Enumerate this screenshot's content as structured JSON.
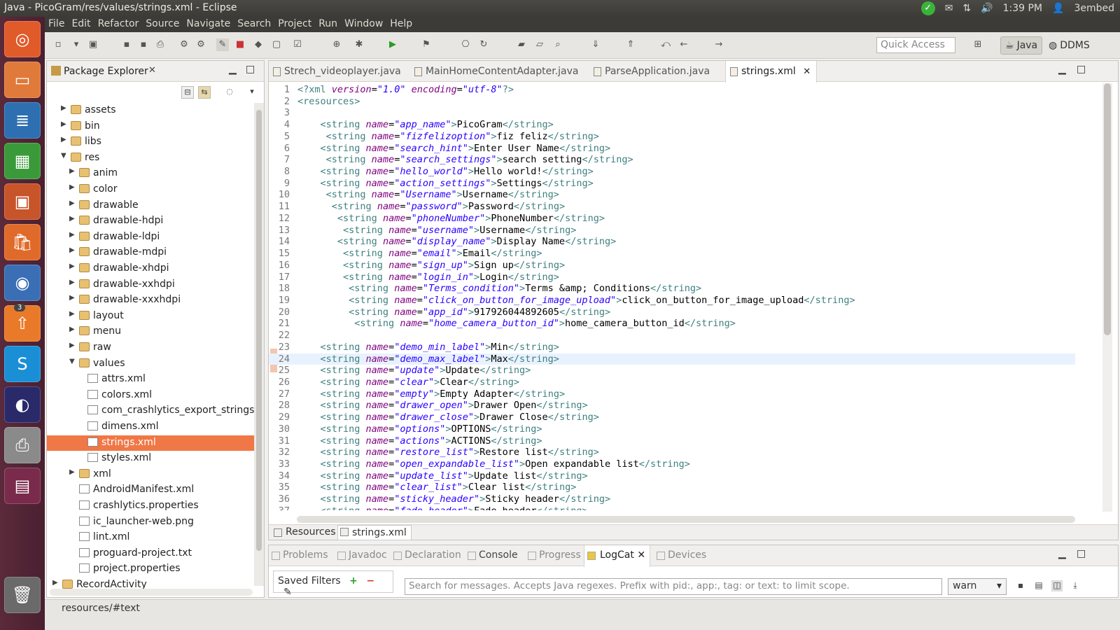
{
  "window_title": "Java - PicoGram/res/values/strings.xml - Eclipse",
  "indicators": {
    "time": "1:39 PM",
    "user": "3embed"
  },
  "launcher": {
    "badge": "3"
  },
  "menu": [
    "File",
    "Edit",
    "Refactor",
    "Source",
    "Navigate",
    "Search",
    "Project",
    "Run",
    "Window",
    "Help"
  ],
  "toolbar": {
    "quick_access_placeholder": "Quick Access"
  },
  "perspectives": {
    "java": "Java",
    "ddms": "DDMS"
  },
  "package_explorer": {
    "title": "Package Explorer",
    "tree": [
      {
        "label": "assets",
        "depth": 0,
        "type": "folder",
        "twisty": "▶"
      },
      {
        "label": "bin",
        "depth": 0,
        "type": "folder",
        "twisty": "▶"
      },
      {
        "label": "libs",
        "depth": 0,
        "type": "folder",
        "twisty": "▶"
      },
      {
        "label": "res",
        "depth": 0,
        "type": "folder",
        "twisty": "▼"
      },
      {
        "label": "anim",
        "depth": 1,
        "type": "folder",
        "twisty": "▶"
      },
      {
        "label": "color",
        "depth": 1,
        "type": "folder",
        "twisty": "▶"
      },
      {
        "label": "drawable",
        "depth": 1,
        "type": "folder",
        "twisty": "▶"
      },
      {
        "label": "drawable-hdpi",
        "depth": 1,
        "type": "folder",
        "twisty": "▶"
      },
      {
        "label": "drawable-ldpi",
        "depth": 1,
        "type": "folder",
        "twisty": "▶"
      },
      {
        "label": "drawable-mdpi",
        "depth": 1,
        "type": "folder",
        "twisty": "▶"
      },
      {
        "label": "drawable-xhdpi",
        "depth": 1,
        "type": "folder",
        "twisty": "▶"
      },
      {
        "label": "drawable-xxhdpi",
        "depth": 1,
        "type": "folder",
        "twisty": "▶"
      },
      {
        "label": "drawable-xxxhdpi",
        "depth": 1,
        "type": "folder",
        "twisty": "▶"
      },
      {
        "label": "layout",
        "depth": 1,
        "type": "folder",
        "twisty": "▶"
      },
      {
        "label": "menu",
        "depth": 1,
        "type": "folder",
        "twisty": "▶"
      },
      {
        "label": "raw",
        "depth": 1,
        "type": "folder",
        "twisty": "▶"
      },
      {
        "label": "values",
        "depth": 1,
        "type": "folder",
        "twisty": "▼"
      },
      {
        "label": "attrs.xml",
        "depth": 2,
        "type": "file",
        "twisty": ""
      },
      {
        "label": "colors.xml",
        "depth": 2,
        "type": "file",
        "twisty": ""
      },
      {
        "label": "com_crashlytics_export_strings.xr",
        "depth": 2,
        "type": "file",
        "twisty": ""
      },
      {
        "label": "dimens.xml",
        "depth": 2,
        "type": "file",
        "twisty": ""
      },
      {
        "label": "strings.xml",
        "depth": 2,
        "type": "file",
        "twisty": "",
        "selected": true
      },
      {
        "label": "styles.xml",
        "depth": 2,
        "type": "file",
        "twisty": ""
      },
      {
        "label": "xml",
        "depth": 1,
        "type": "folder",
        "twisty": "▶"
      },
      {
        "label": "AndroidManifest.xml",
        "depth": 1,
        "type": "file",
        "twisty": ""
      },
      {
        "label": "crashlytics.properties",
        "depth": 1,
        "type": "file",
        "twisty": ""
      },
      {
        "label": "ic_launcher-web.png",
        "depth": 1,
        "type": "file",
        "twisty": ""
      },
      {
        "label": "lint.xml",
        "depth": 1,
        "type": "file",
        "twisty": ""
      },
      {
        "label": "proguard-project.txt",
        "depth": 1,
        "type": "file",
        "twisty": ""
      },
      {
        "label": "project.properties",
        "depth": 1,
        "type": "file",
        "twisty": ""
      },
      {
        "label": "RecordActivity",
        "depth": -1,
        "type": "folder",
        "twisty": "▶"
      }
    ]
  },
  "editor": {
    "tabs": [
      "Strech_videoplayer.java",
      "MainHomeContentAdapter.java",
      "ParseApplication.java",
      "strings.xml"
    ],
    "active_tab": 3,
    "bottom_tabs": [
      "Resources",
      "strings.xml"
    ],
    "current_line": 24,
    "lines": [
      {
        "n": "1",
        "raw": "<?xml version=\"1.0\" encoding=\"utf-8\"?>"
      },
      {
        "n": "2",
        "raw": "<resources>"
      },
      {
        "n": "3",
        "raw": ""
      },
      {
        "n": "4",
        "indent": "    ",
        "name": "app_name",
        "text": "PicoGram"
      },
      {
        "n": "5",
        "indent": "     ",
        "name": "fizfelizoption",
        "text": "fiz feliz"
      },
      {
        "n": "6",
        "indent": "    ",
        "name": "search_hint",
        "text": "Enter User Name"
      },
      {
        "n": "7",
        "indent": "     ",
        "name": "search_settings",
        "text": "search setting"
      },
      {
        "n": "8",
        "indent": "    ",
        "name": "hello_world",
        "text": "Hello world!"
      },
      {
        "n": "9",
        "indent": "    ",
        "name": "action_settings",
        "text": "Settings"
      },
      {
        "n": "10",
        "indent": "     ",
        "name": "Username",
        "text": "Username"
      },
      {
        "n": "11",
        "indent": "      ",
        "name": "password",
        "text": "Password"
      },
      {
        "n": "12",
        "indent": "       ",
        "name": "phoneNumber",
        "text": "PhoneNumber"
      },
      {
        "n": "13",
        "indent": "        ",
        "name": "username",
        "text": "Username"
      },
      {
        "n": "14",
        "indent": "       ",
        "name": "display_name",
        "text": "Display Name"
      },
      {
        "n": "15",
        "indent": "        ",
        "name": "email",
        "text": "Email"
      },
      {
        "n": "16",
        "indent": "        ",
        "name": "sign_up",
        "text": "Sign up"
      },
      {
        "n": "17",
        "indent": "        ",
        "name": "login_in",
        "text": "Login"
      },
      {
        "n": "18",
        "indent": "         ",
        "name": "Terms_condition",
        "text": "Terms &amp; Conditions"
      },
      {
        "n": "19",
        "indent": "         ",
        "name": "click_on_button_for_image_upload",
        "text": "click_on_button_for_image_upload"
      },
      {
        "n": "20",
        "indent": "         ",
        "name": "app_id",
        "text": "917926044892605"
      },
      {
        "n": "21",
        "indent": "          ",
        "name": "home_camera_button_id",
        "text": "home_camera_button_id"
      },
      {
        "n": "22",
        "raw": ""
      },
      {
        "n": "23",
        "indent": "    ",
        "name": "demo_min_label",
        "text": "Min"
      },
      {
        "n": "24",
        "indent": "    ",
        "name": "demo_max_label",
        "text": "Max"
      },
      {
        "n": "25",
        "indent": "    ",
        "name": "update",
        "text": "Update"
      },
      {
        "n": "26",
        "indent": "    ",
        "name": "clear",
        "text": "Clear"
      },
      {
        "n": "27",
        "indent": "    ",
        "name": "empty",
        "text": "Empty Adapter"
      },
      {
        "n": "28",
        "indent": "    ",
        "name": "drawer_open",
        "text": "Drawer Open"
      },
      {
        "n": "29",
        "indent": "    ",
        "name": "drawer_close",
        "text": "Drawer Close"
      },
      {
        "n": "30",
        "indent": "    ",
        "name": "options",
        "text": "OPTIONS"
      },
      {
        "n": "31",
        "indent": "    ",
        "name": "actions",
        "text": "ACTIONS"
      },
      {
        "n": "32",
        "indent": "    ",
        "name": "restore_list",
        "text": "Restore list"
      },
      {
        "n": "33",
        "indent": "    ",
        "name": "open_expandable_list",
        "text": "Open expandable list"
      },
      {
        "n": "34",
        "indent": "    ",
        "name": "update_list",
        "text": "Update list"
      },
      {
        "n": "35",
        "indent": "    ",
        "name": "clear_list",
        "text": "Clear list"
      },
      {
        "n": "36",
        "indent": "    ",
        "name": "sticky_header",
        "text": "Sticky header"
      },
      {
        "n": "37",
        "indent": "    ",
        "name": "fade_header",
        "text": "Fade header"
      }
    ]
  },
  "bottom_panel": {
    "tabs": [
      "Problems",
      "Javadoc",
      "Declaration",
      "Console",
      "Progress",
      "LogCat",
      "Devices"
    ],
    "active_tab": 5,
    "saved_filters": "Saved Filters",
    "search_placeholder": "Search for messages. Accepts Java regexes. Prefix with pid:, app:, tag: or text: to limit scope.",
    "level": "warn"
  },
  "statusbar": {
    "text": "resources/#text"
  }
}
